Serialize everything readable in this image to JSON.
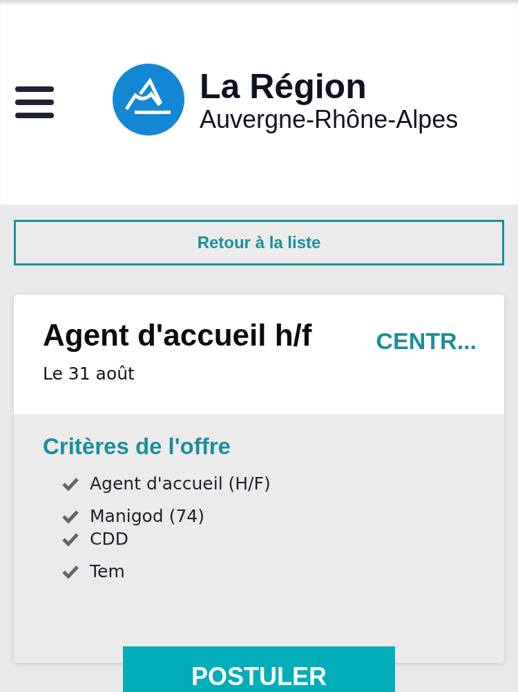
{
  "header": {
    "logo_title": "La Région",
    "logo_subtitle": "Auvergne-Rhône-Alpes"
  },
  "back_button": "Retour à la liste",
  "offer": {
    "title": "Agent d'accueil h/f",
    "employer": "CENTR...",
    "date": "Le 31 août"
  },
  "criteria": {
    "heading": "Critères de l'offre",
    "items": [
      {
        "text": "Agent d'accueil (H/F)"
      },
      {
        "text": "Manigod (74)"
      },
      {
        "text": "CDD"
      },
      {
        "text": "Tem"
      }
    ]
  },
  "apply_button": "POSTULER"
}
